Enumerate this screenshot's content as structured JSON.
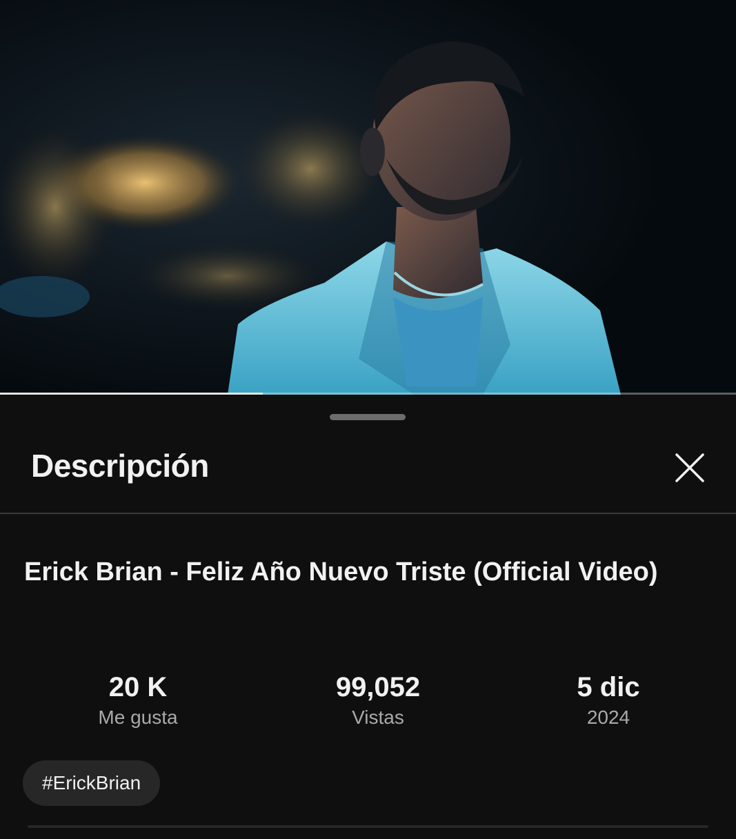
{
  "player": {
    "progress_percent": 35.7
  },
  "description_panel": {
    "header_title": "Descripción",
    "close_icon": "close-icon",
    "video_title": "Erick Brian - Feliz Año Nuevo Triste (Official Video)",
    "stats": [
      {
        "value": "20 K",
        "label": "Me gusta"
      },
      {
        "value": "99,052",
        "label": "Vistas"
      },
      {
        "value": "5 dic",
        "label": "2024"
      }
    ],
    "hashtag": "#ErickBrian"
  },
  "colors": {
    "background": "#0f0f0f",
    "chip_background": "#272727",
    "secondary_text": "#aaaaaa",
    "primary_text": "#f1f1f1"
  }
}
